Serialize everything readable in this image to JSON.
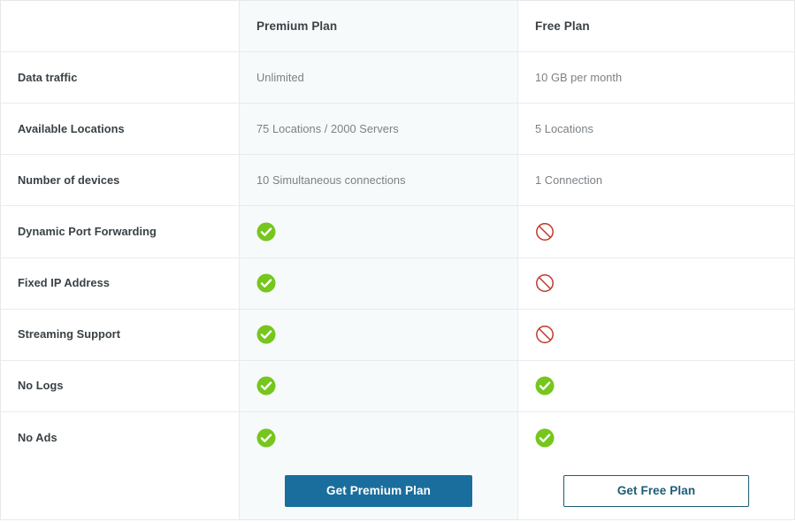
{
  "table": {
    "columns": [
      {
        "key": "feature",
        "label": ""
      },
      {
        "key": "premium",
        "label": "Premium Plan"
      },
      {
        "key": "free",
        "label": "Free Plan"
      }
    ],
    "rows": [
      {
        "label": "Data traffic",
        "premium": {
          "type": "text",
          "value": "Unlimited"
        },
        "free": {
          "type": "text",
          "value": "10 GB per month"
        }
      },
      {
        "label": "Available Locations",
        "premium": {
          "type": "text",
          "value": "75 Locations / 2000 Servers"
        },
        "free": {
          "type": "text",
          "value": "5 Locations"
        }
      },
      {
        "label": "Number of devices",
        "premium": {
          "type": "text",
          "value": "10 Simultaneous connections"
        },
        "free": {
          "type": "text",
          "value": "1 Connection"
        }
      },
      {
        "label": "Dynamic Port Forwarding",
        "premium": {
          "type": "icon",
          "icon": "check-circle-icon"
        },
        "free": {
          "type": "icon",
          "icon": "prohibited-icon"
        }
      },
      {
        "label": "Fixed IP Address",
        "premium": {
          "type": "icon",
          "icon": "check-circle-icon"
        },
        "free": {
          "type": "icon",
          "icon": "prohibited-icon"
        }
      },
      {
        "label": "Streaming Support",
        "premium": {
          "type": "icon",
          "icon": "check-circle-icon"
        },
        "free": {
          "type": "icon",
          "icon": "prohibited-icon"
        }
      },
      {
        "label": "No Logs",
        "premium": {
          "type": "icon",
          "icon": "check-circle-icon"
        },
        "free": {
          "type": "icon",
          "icon": "check-circle-icon"
        }
      },
      {
        "label": "No Ads",
        "premium": {
          "type": "icon",
          "icon": "check-circle-icon"
        },
        "free": {
          "type": "icon",
          "icon": "check-circle-icon"
        }
      }
    ],
    "cta": {
      "premium_label": "Get Premium Plan",
      "free_label": "Get Free Plan"
    }
  },
  "colors": {
    "check_green": "#76c61d",
    "prohibited_red": "#c0392b",
    "premium_button_bg": "#1a6e9e",
    "free_button_border": "#1d5d75",
    "premium_column_tint": "#f7fafb",
    "label_text": "#3a4145",
    "value_text": "#7b8185",
    "table_border": "#e8ebed"
  }
}
